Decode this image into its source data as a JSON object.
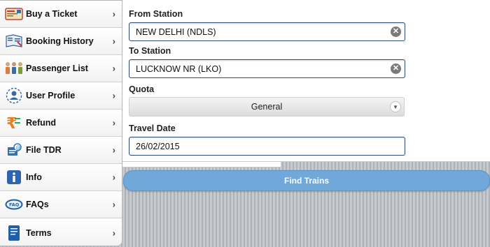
{
  "sidebar": {
    "items": [
      {
        "label": "Buy a Ticket",
        "icon": "ticket-icon"
      },
      {
        "label": "Booking History",
        "icon": "book-icon"
      },
      {
        "label": "Passenger List",
        "icon": "people-icon"
      },
      {
        "label": "User Profile",
        "icon": "user-profile-icon"
      },
      {
        "label": "Refund",
        "icon": "rupee-icon"
      },
      {
        "label": "File TDR",
        "icon": "file-tdr-icon"
      },
      {
        "label": "Info",
        "icon": "info-icon"
      },
      {
        "label": "FAQs",
        "icon": "faq-icon"
      },
      {
        "label": "Terms",
        "icon": "document-icon"
      }
    ]
  },
  "form": {
    "from_label": "From Station",
    "from_value": "NEW DELHI (NDLS)",
    "to_label": "To Station",
    "to_value": "LUCKNOW NR (LKO)",
    "quota_label": "Quota",
    "quota_value": "General",
    "date_label": "Travel Date",
    "date_value": "26/02/2015",
    "submit_label": "Find Trains"
  },
  "colors": {
    "button": "#6fa8d9",
    "input_border": "#2d4b7a"
  }
}
